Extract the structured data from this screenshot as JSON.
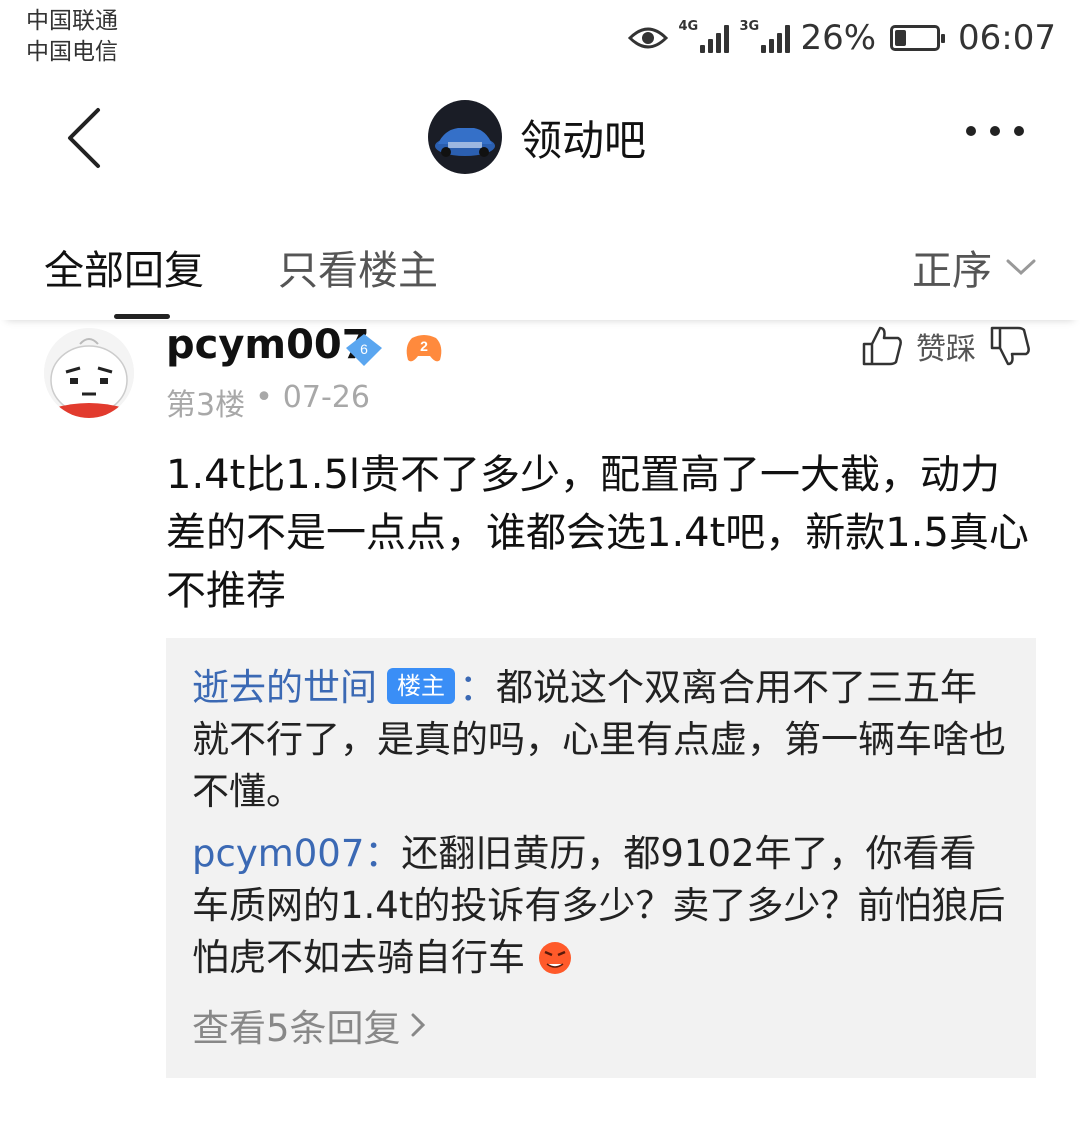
{
  "status_bar": {
    "carrier1": "中国联通",
    "carrier2": "中国电信",
    "signal1_label": "4G",
    "signal2_label": "3G",
    "battery_percent": "26%",
    "battery_level": 0.26,
    "time": "06:07"
  },
  "header": {
    "title": "领动吧"
  },
  "tabs": {
    "all_replies": "全部回复",
    "only_op": "只看楼主",
    "sort": "正序"
  },
  "post": {
    "username": "pcym007",
    "level": "6",
    "game_badge": "2",
    "floor": "第3楼",
    "separator": "•",
    "date": "07-26",
    "vote_label": "赞踩",
    "content": "1.4t比1.5l贵不了多少，配置高了一大截，动力差的不是一点点，谁都会选1.4t吧，新款1.5真心不推荐"
  },
  "sub_replies": [
    {
      "name": "逝去的世间",
      "tag": "楼主",
      "colon": "：",
      "text": "都说这个双离合用不了三五年就不行了，是真的吗，心里有点虚，第一辆车啥也不懂。"
    },
    {
      "name": "pcym007",
      "colon": "：",
      "text": "还翻旧黄历，都9102年了，你看看车质网的1.4t的投诉有多少？卖了多少？前怕狼后怕虎不如去骑自行车"
    }
  ],
  "view_more": "查看5条回复",
  "colors": {
    "link_blue": "#3b69b4",
    "owner_tag": "#3a8ef6",
    "sub_bg": "#f2f2f2"
  }
}
